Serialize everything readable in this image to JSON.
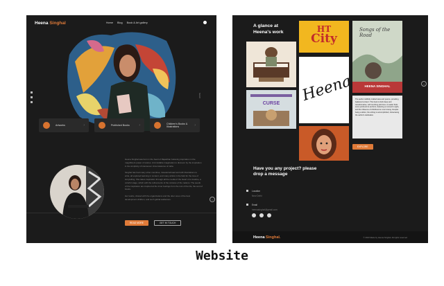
{
  "left_page": {
    "logo_first": "Heena",
    "logo_last": "Singhal",
    "nav_links": [
      "Home",
      "Blog",
      "Book & Art gallery"
    ],
    "cards": [
      {
        "label": "Artworks"
      },
      {
        "label": "Published Books"
      },
      {
        "label": "Children's Books & Illustrations"
      }
    ],
    "side_text": "Scroll",
    "about_paragraphs": [
      "Heena Singhal was born in the heart of Rajasthan believing inspiration in the magnificent power of stories. A formidable imagination to discover by the inspiration in the simplicity of interwoven circumstances of india.",
      "Singhal has had many other countries, traveled abroad and with illustrations to write, all explored learning in content, and many artists in the field for the love of storytelling. She takes inspiration through all the media of the Heart of a creative, a colorful stage, which with the refinements of the cultures of the nations. The seeds of the inspiration are inspired at the inner feelings from the root of the life, the soul of books.",
      "Her works, shared with the organizations and the utter ones of the best development children, and such global audiences."
    ],
    "primary_button": "READ MORE",
    "secondary_button": "GET IN TOUCH"
  },
  "right_page": {
    "section_title": "A glance at Heena's work",
    "tile_city_line1": "HT",
    "tile_city_line2": "City",
    "tile_book_title": "Songs of the Road",
    "tile_book_author": "HEENA SINGHAL",
    "tile_curse_title": "CURSE",
    "tile_signature": "Heena",
    "quote_text": "The author skillfully crafted tales and poems, providing balanced content. This book is both deep and transformative, with touching plot lines. A reader finds some profound to anchors, featuring a moment's sighs, and the influence of childhood on one's being. Despite being a debut, the writing is accomplished, showcasing the author's dedication.",
    "quote_button": "EXPLORE",
    "contact_title": "Have you any project? please drop a message",
    "location_label": "Location",
    "location_value": "New Delhi",
    "email_label": "Email",
    "email_value": "heenasinghal@gmail.com",
    "footer_logo_first": "Heena",
    "footer_logo_last": "Singhal.",
    "copyright": "© 2023 Made by Heena Singhal. All rights reserved"
  },
  "caption": "Website",
  "colors": {
    "accent": "#e07b39",
    "background": "#1b1b1b",
    "card": "#2a2a2a"
  }
}
